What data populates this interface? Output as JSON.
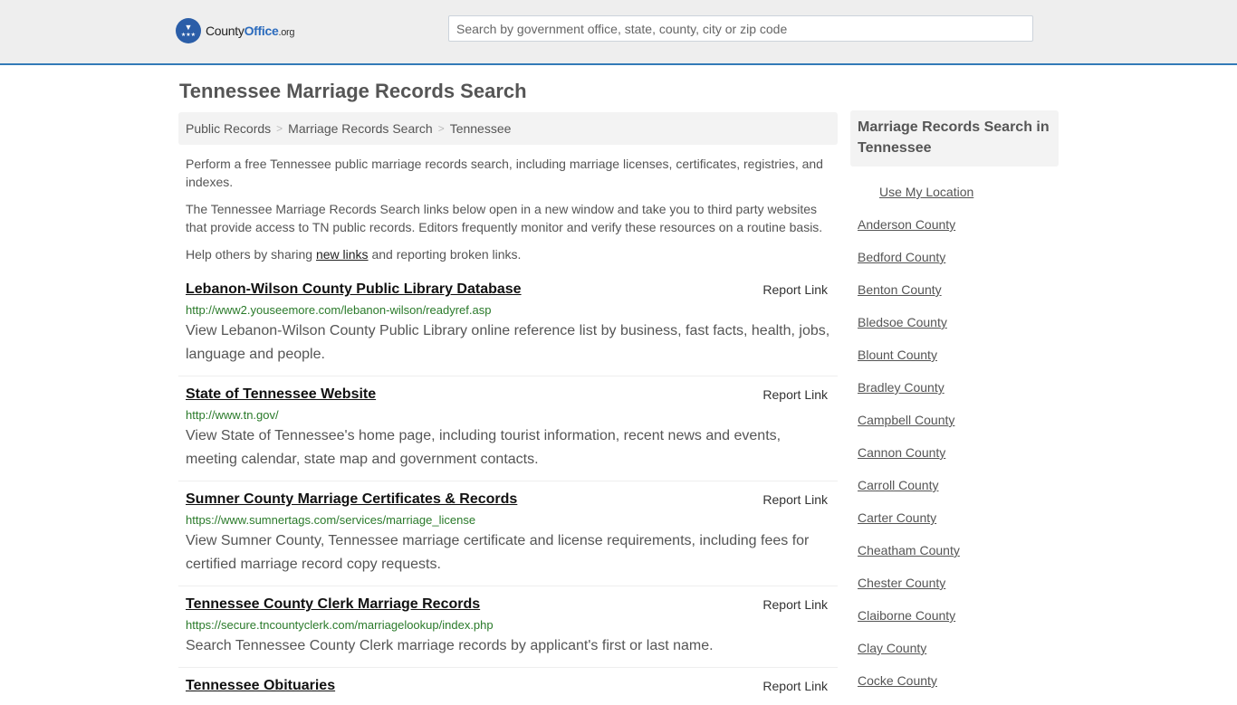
{
  "header": {
    "logo": {
      "name_part1": "County",
      "name_part2": "Office",
      "suffix": ".org",
      "icon": "eagle-stars-badge-icon"
    },
    "search_placeholder": "Search by government office, state, county, city or zip code",
    "accent_color": "#337ab7"
  },
  "page_title": "Tennessee Marriage Records Search",
  "breadcrumb": {
    "items": [
      "Public Records",
      "Marriage Records Search"
    ],
    "current": "Tennessee",
    "separator": ">"
  },
  "intro": {
    "p1": "Perform a free Tennessee public marriage records search, including marriage licenses, certificates, registries, and indexes.",
    "p2": "The Tennessee Marriage Records Search links below open in a new window and take you to third party websites that provide access to TN public records. Editors frequently monitor and verify these resources on a routine basis.",
    "p3_before": "Help others by sharing ",
    "p3_link": "new links",
    "p3_after": " and reporting broken links."
  },
  "results": [
    {
      "title": "Lebanon-Wilson County Public Library Database",
      "url": "http://www2.youseemore.com/lebanon-wilson/readyref.asp",
      "description": "View Lebanon-Wilson County Public Library online reference list by business, fast facts, health, jobs, language and people.",
      "report_label": "Report Link"
    },
    {
      "title": "State of Tennessee Website",
      "url": "http://www.tn.gov/",
      "description": "View State of Tennessee's home page, including tourist information, recent news and events, meeting calendar, state map and government contacts.",
      "report_label": "Report Link"
    },
    {
      "title": "Sumner County Marriage Certificates & Records",
      "url": "https://www.sumnertags.com/services/marriage_license",
      "description": "View Sumner County, Tennessee marriage certificate and license requirements, including fees for certified marriage record copy requests.",
      "report_label": "Report Link"
    },
    {
      "title": "Tennessee County Clerk Marriage Records",
      "url": "https://secure.tncountyclerk.com/marriagelookup/index.php",
      "description": "Search Tennessee County Clerk marriage records by applicant's first or last name.",
      "report_label": "Report Link"
    },
    {
      "title": "Tennessee Obituaries",
      "url": "",
      "description": "",
      "report_label": "Report Link"
    }
  ],
  "sidebar": {
    "heading": "Marriage Records Search in Tennessee",
    "use_location": "Use My Location",
    "counties": [
      "Anderson County",
      "Bedford County",
      "Benton County",
      "Bledsoe County",
      "Blount County",
      "Bradley County",
      "Campbell County",
      "Cannon County",
      "Carroll County",
      "Carter County",
      "Cheatham County",
      "Chester County",
      "Claiborne County",
      "Clay County",
      "Cocke County"
    ]
  }
}
